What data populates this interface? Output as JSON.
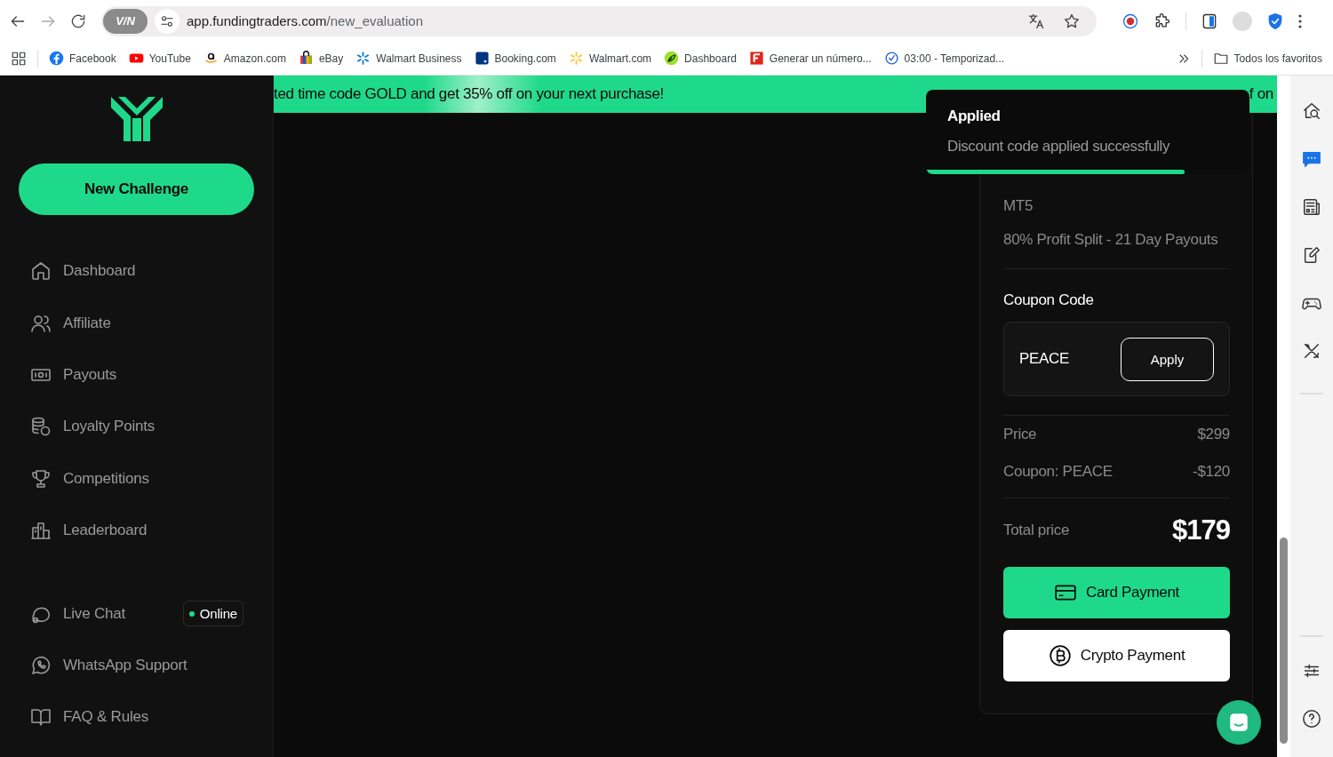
{
  "browser": {
    "vpn_badge": "V/N",
    "url_host": "app.fundingtraders.com",
    "url_path": "/new_evaluation",
    "bookmarks": [
      {
        "kind": "facebook",
        "label": "Facebook"
      },
      {
        "kind": "youtube",
        "label": "YouTube"
      },
      {
        "kind": "amazon",
        "label": "Amazon.com"
      },
      {
        "kind": "ebay",
        "label": "eBay"
      },
      {
        "kind": "spark",
        "label": "Walmart Business"
      },
      {
        "kind": "booking",
        "label": "Booking.com"
      },
      {
        "kind": "spark2",
        "label": "Walmart.com"
      },
      {
        "kind": "leaf",
        "label": "Dashboard"
      },
      {
        "kind": "letterf",
        "label": "Generar un número..."
      },
      {
        "kind": "timer",
        "label": "03:00 - Temporizad..."
      }
    ],
    "all_bookmarks": "Todos los favoritos"
  },
  "sidebar": {
    "new_challenge": "New Challenge",
    "items": [
      {
        "kind": "home",
        "label": "Dashboard"
      },
      {
        "kind": "users",
        "label": "Affiliate"
      },
      {
        "kind": "cash",
        "label": "Payouts"
      },
      {
        "kind": "coins",
        "label": "Loyalty Points"
      },
      {
        "kind": "trophy",
        "label": "Competitions"
      },
      {
        "kind": "podium",
        "label": "Leaderboard"
      }
    ],
    "support": [
      {
        "kind": "chat",
        "label": "Live Chat",
        "badge": "Online"
      },
      {
        "kind": "whatsapp",
        "label": "WhatsApp Support"
      },
      {
        "kind": "book",
        "label": "FAQ & Rules"
      }
    ]
  },
  "banner": {
    "text": "ted time code GOLD and get 35% off on your next purchase!",
    "tail": "f on"
  },
  "toast": {
    "title": "Applied",
    "message": "Discount code applied successfully",
    "level": 0.8
  },
  "order": {
    "details": [
      "MT5",
      "80% Profit Split - 21 Day Payouts"
    ],
    "coupon_heading": "Coupon Code",
    "coupon_value": "PEACE",
    "apply": "Apply",
    "lines": [
      {
        "label": "Price",
        "value": "$299"
      },
      {
        "label": "Coupon: PEACE",
        "value": "-$120"
      }
    ],
    "total": {
      "label": "Total price",
      "value": "$179"
    },
    "payments": [
      {
        "kind": "card",
        "label": "Card Payment"
      },
      {
        "kind": "crypto",
        "label": "Crypto Payment"
      }
    ]
  }
}
